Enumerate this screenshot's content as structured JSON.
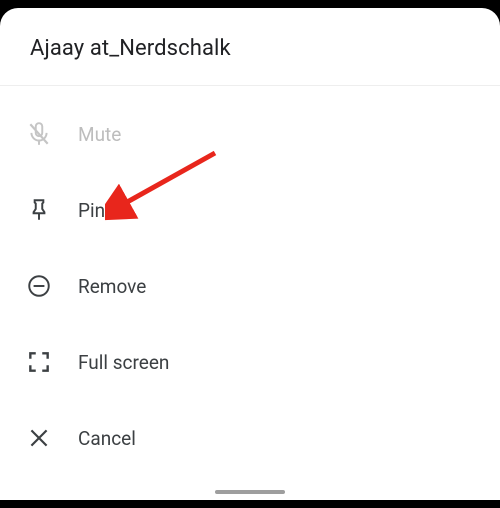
{
  "header": {
    "title": "Ajaay at_Nerdschalk"
  },
  "menu": {
    "mute": {
      "label": "Mute"
    },
    "pin": {
      "label": "Pin"
    },
    "remove": {
      "label": "Remove"
    },
    "fullscreen": {
      "label": "Full screen"
    },
    "cancel": {
      "label": "Cancel"
    }
  },
  "annotation": {
    "arrow_color": "#e8261c"
  }
}
